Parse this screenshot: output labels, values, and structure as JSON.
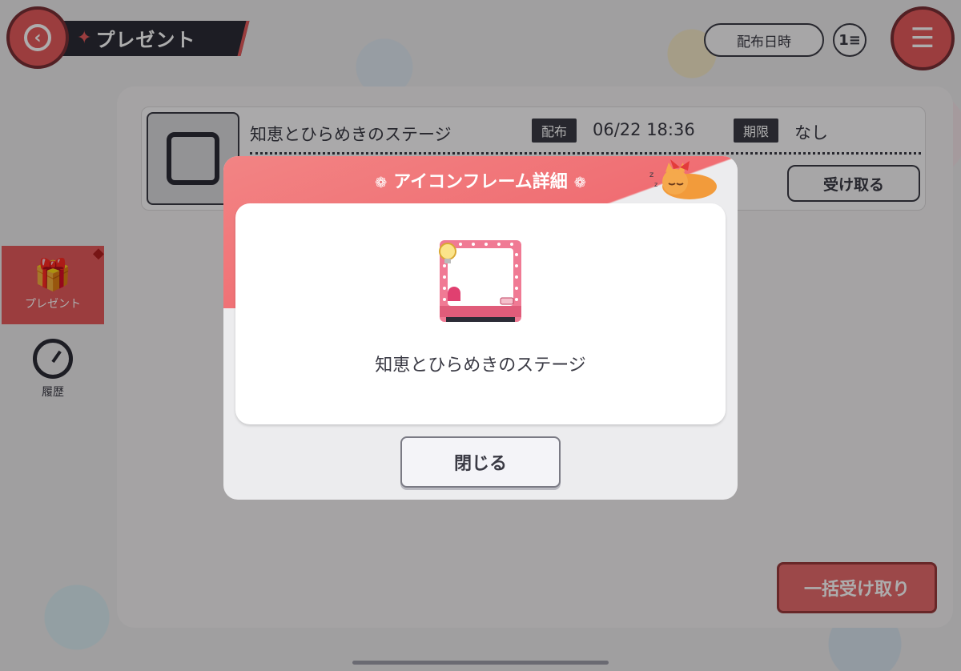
{
  "header": {
    "title": "プレゼント",
    "sort_label": "配布日時",
    "order_icon": "sort-order-icon",
    "back_icon": "back-arrow-icon",
    "menu_icon": "menu-list-icon"
  },
  "sidebar": {
    "items": [
      {
        "label": "プレゼント",
        "icon": "gift-icon",
        "active": true
      },
      {
        "label": "履歴",
        "icon": "history-clock-icon",
        "active": false
      }
    ]
  },
  "item": {
    "name": "知恵とひらめきのステージ",
    "dist_tag": "配布",
    "dist_value": "06/22 18:36",
    "limit_tag": "期限",
    "limit_value": "なし",
    "receive_label": "受け取る"
  },
  "bulk_receive_label": "一括受け取り",
  "modal": {
    "title": "アイコンフレーム詳細",
    "item_name": "知恵とひらめきのステージ",
    "close_label": "閉じる"
  },
  "colors": {
    "accent": "#e55a5c",
    "dark": "#2c2c36",
    "modal_header": "#f06e73"
  }
}
